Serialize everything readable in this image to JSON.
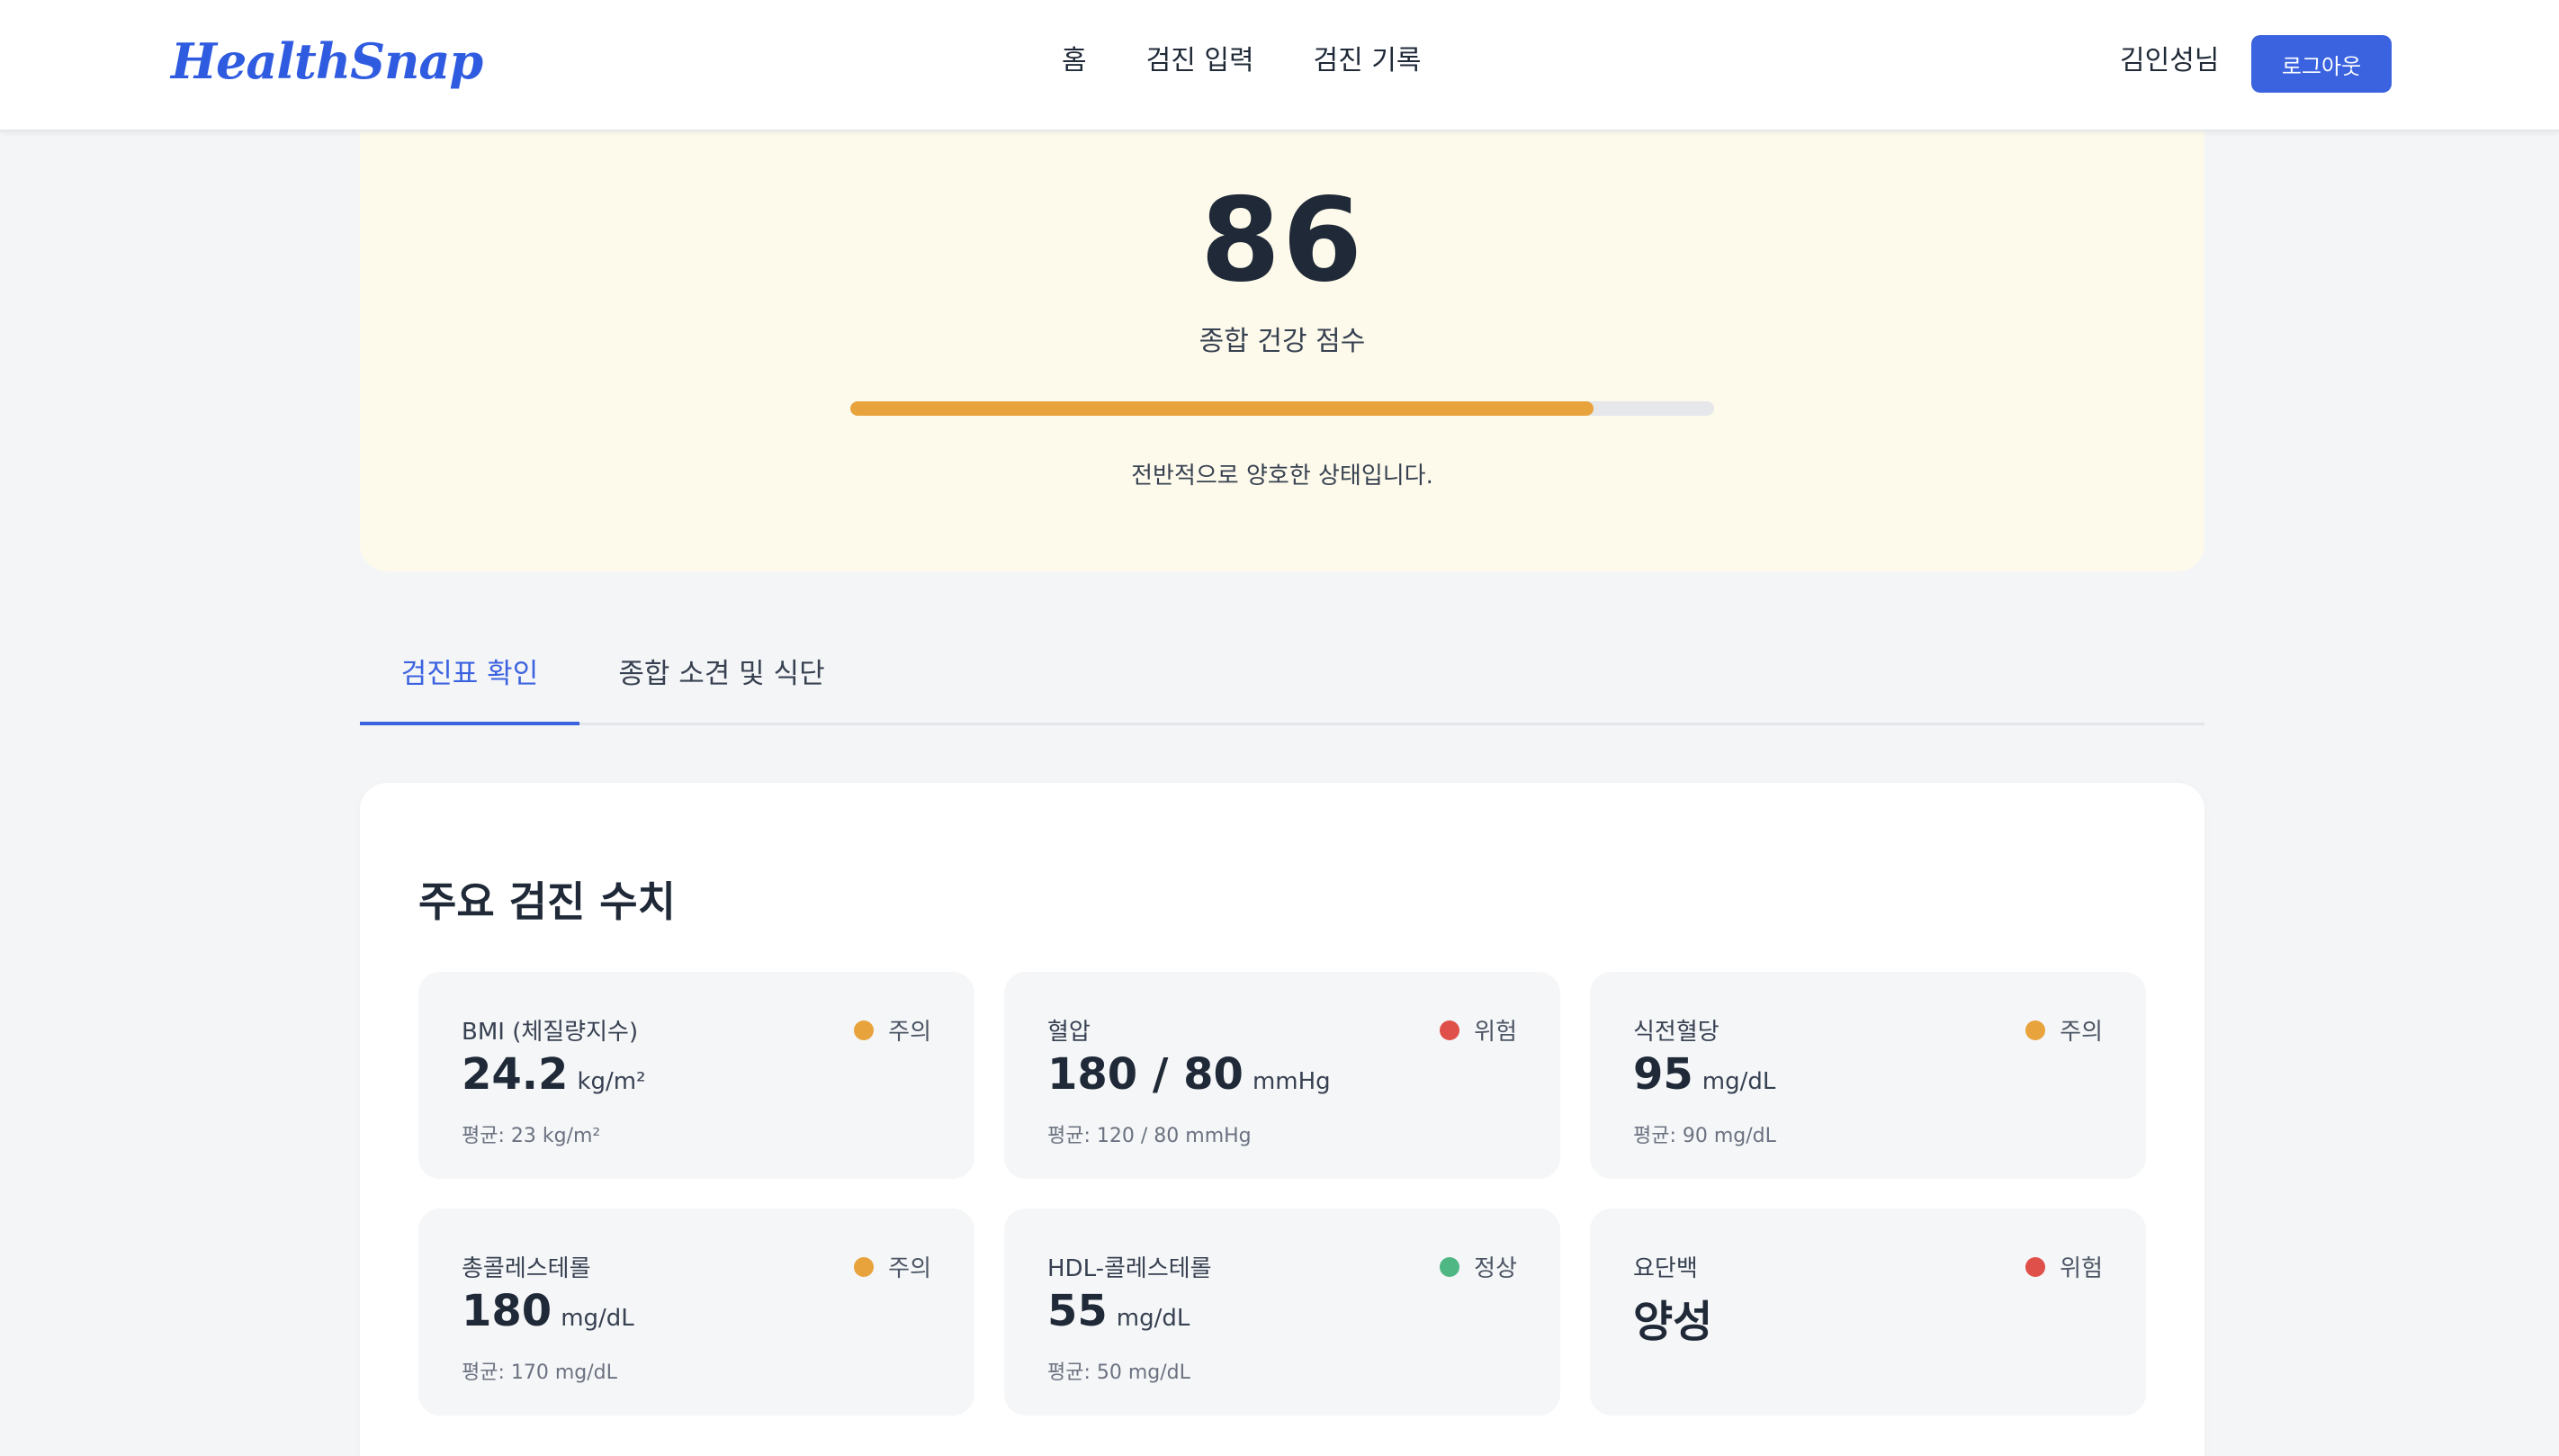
{
  "header": {
    "logo": "HealthSnap",
    "nav": [
      "홈",
      "검진 입력",
      "검진 기록"
    ],
    "user_name": "김인성님",
    "logout_label": "로그아웃"
  },
  "score": {
    "value": "86",
    "label": "종합 건강 점수",
    "progress_percent": 86,
    "message": "전반적으로 양호한 상태입니다."
  },
  "tabs": [
    {
      "label": "검진표 확인",
      "active": true
    },
    {
      "label": "종합 소견 및 식단",
      "active": false
    }
  ],
  "section": {
    "title": "주요 검진 수치"
  },
  "status_colors": {
    "주의": "#e8a33d",
    "위험": "#e0504a",
    "정상": "#4fb784"
  },
  "metrics": [
    {
      "name": "BMI (체질량지수)",
      "status": "주의",
      "value": "24.2",
      "unit": "kg/m²",
      "avg": "평균: 23 kg/m²"
    },
    {
      "name": "혈압",
      "status": "위험",
      "value": "180 / 80",
      "unit": "mmHg",
      "avg": "평균: 120 / 80 mmHg"
    },
    {
      "name": "식전혈당",
      "status": "주의",
      "value": "95",
      "unit": "mg/dL",
      "avg": "평균: 90 mg/dL"
    },
    {
      "name": "총콜레스테롤",
      "status": "주의",
      "value": "180",
      "unit": "mg/dL",
      "avg": "평균: 170 mg/dL"
    },
    {
      "name": "HDL-콜레스테롤",
      "status": "정상",
      "value": "55",
      "unit": "mg/dL",
      "avg": "평균: 50 mg/dL"
    },
    {
      "name": "요단백",
      "status": "위험",
      "value": "양성",
      "unit": "",
      "avg": ""
    }
  ]
}
